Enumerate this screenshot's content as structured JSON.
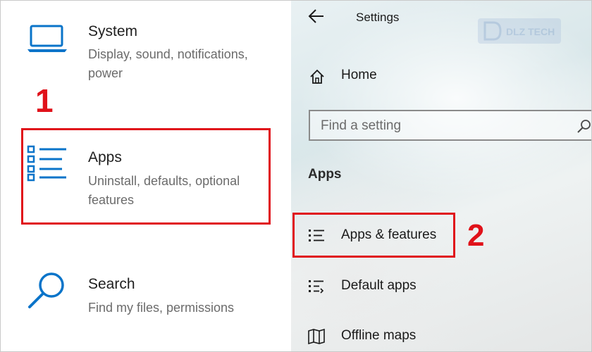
{
  "left_panel": {
    "categories": [
      {
        "title": "System",
        "description": "Display, sound, notifications, power",
        "icon": "laptop-icon"
      },
      {
        "title": "Apps",
        "description": "Uninstall, defaults, optional features",
        "icon": "apps-list-icon"
      },
      {
        "title": "Search",
        "description": "Find my files, permissions",
        "icon": "search-icon"
      }
    ],
    "step_marker": "1"
  },
  "right_panel": {
    "window_title": "Settings",
    "watermark": "DLZ TECH",
    "home_label": "Home",
    "search": {
      "placeholder": "Find a setting"
    },
    "section_heading": "Apps",
    "nav_items": [
      {
        "label": "Apps & features",
        "icon": "apps-features-icon"
      },
      {
        "label": "Default apps",
        "icon": "default-apps-icon"
      },
      {
        "label": "Offline maps",
        "icon": "offline-maps-icon"
      }
    ],
    "step_marker": "2"
  },
  "colors": {
    "accent_blue": "#0a74c9",
    "highlight_red": "#e0121a",
    "text_primary": "#1f1f1f",
    "text_secondary": "#6b6b6b"
  }
}
